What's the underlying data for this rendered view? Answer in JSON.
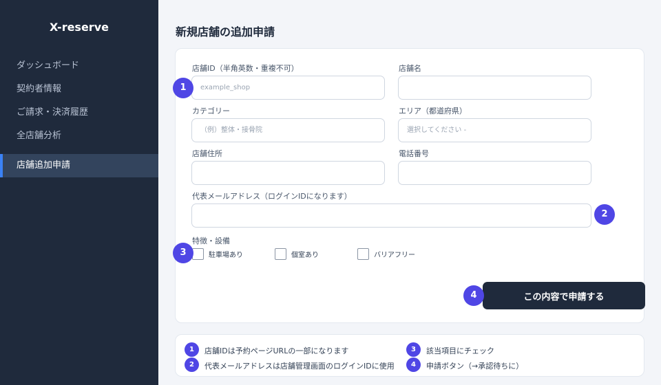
{
  "sidebar": {
    "brand": "X-reserve",
    "items": [
      {
        "label": "ダッシュボード",
        "active": false
      },
      {
        "label": "契約者情報",
        "active": false
      },
      {
        "label": "ご請求・決済履歴",
        "active": false
      },
      {
        "label": "全店舗分析",
        "active": false
      },
      {
        "label": "店舗追加申請",
        "active": true
      }
    ]
  },
  "page": {
    "title": "新規店舗の追加申請"
  },
  "form": {
    "shop_id": {
      "label": "店舗ID（半角英数・重複不可）",
      "placeholder": "example_shop",
      "value": ""
    },
    "shop_name": {
      "label": "店舗名",
      "placeholder": "",
      "value": ""
    },
    "category": {
      "label": "カテゴリー",
      "placeholder": "（例）整体・接骨院",
      "value": ""
    },
    "area": {
      "label": "エリア（都道府県）",
      "selected": "選択してください -"
    },
    "address": {
      "label": "店舗住所",
      "placeholder": "",
      "value": ""
    },
    "phone": {
      "label": "電話番号",
      "placeholder": "",
      "value": ""
    },
    "email": {
      "label": "代表メールアドレス（ログインIDになります）",
      "placeholder": "",
      "value": ""
    },
    "features": {
      "label": "特徴・設備",
      "options": [
        {
          "label": "駐車場あり",
          "checked": false
        },
        {
          "label": "個室あり",
          "checked": false
        },
        {
          "label": "バリアフリー",
          "checked": false
        }
      ]
    },
    "submit_label": "この内容で申請する"
  },
  "markers": [
    "1",
    "2",
    "3",
    "4"
  ],
  "legend": [
    {
      "num": "1",
      "text": "店舗IDは予約ページURLの一部になります"
    },
    {
      "num": "2",
      "text": "代表メールアドレスは店舗管理画面のログインIDに使用"
    },
    {
      "num": "3",
      "text": "該当項目にチェック"
    },
    {
      "num": "4",
      "text": "申請ボタン（→承認待ちに）"
    }
  ],
  "colors": {
    "sidebar_bg": "#1f2a3c",
    "accent": "#4f46e5",
    "active_border": "#3b82f6"
  }
}
